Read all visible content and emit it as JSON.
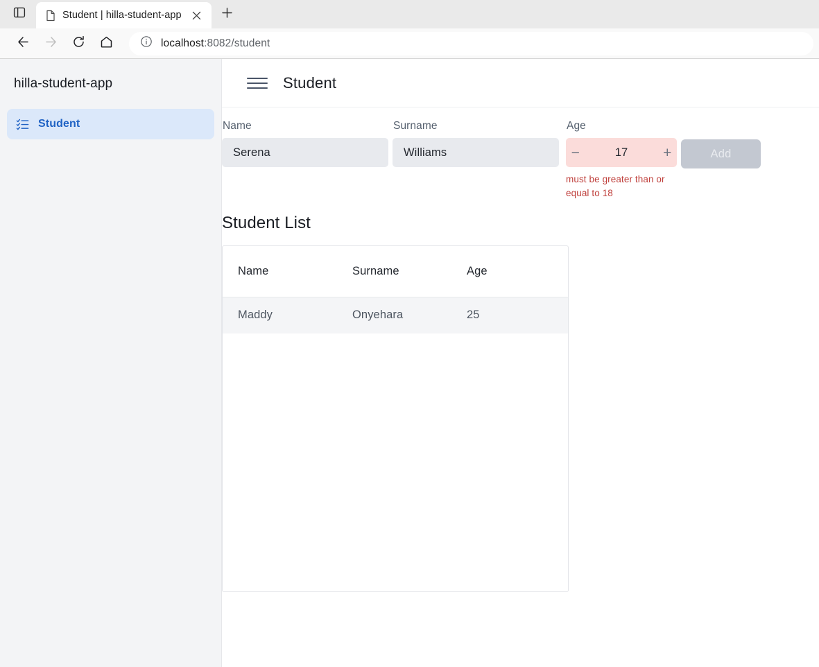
{
  "browser": {
    "tab": {
      "title": "Student | hilla-student-app",
      "favicon_icon": "page-icon",
      "close_icon": "close-icon"
    },
    "new_tab_icon": "plus-icon",
    "tab_search_icon": "tab-list-icon",
    "toolbar": {
      "back_icon": "arrow-left-icon",
      "forward_icon": "arrow-right-icon",
      "reload_icon": "reload-icon",
      "home_icon": "home-icon",
      "site_info_icon": "info-circle-icon",
      "url_host": "localhost",
      "url_path": ":8082/student",
      "url_full": "localhost:8082/student"
    }
  },
  "sidebar": {
    "brand": "hilla-student-app",
    "items": [
      {
        "label": "Student",
        "icon": "checklist-icon",
        "selected": true
      }
    ]
  },
  "header": {
    "menu_icon": "hamburger-icon",
    "title": "Student"
  },
  "form": {
    "name": {
      "label": "Name",
      "value": "Serena",
      "placeholder": ""
    },
    "surname": {
      "label": "Surname",
      "value": "Williams",
      "placeholder": ""
    },
    "age": {
      "label": "Age",
      "value": "17",
      "decrement_icon": "minus-icon",
      "increment_icon": "plus-icon",
      "error": "must be greater than or equal to 18",
      "invalid": true
    },
    "submit": {
      "label": "Add",
      "disabled": true
    }
  },
  "list": {
    "heading": "Student List",
    "columns": [
      "Name",
      "Surname",
      "Age"
    ],
    "rows": [
      {
        "name": "Maddy",
        "surname": "Onyehara",
        "age": "25"
      }
    ]
  },
  "colors": {
    "accent": "#1f62c4",
    "nav_selected_bg": "#dbe8fa",
    "input_bg": "#e8eaee",
    "invalid_bg": "#fbdcda",
    "error_text": "#bf3f3b",
    "disabled_button_bg": "#c3c8d1",
    "sidebar_bg": "#f3f4f6",
    "row_stripe": "#f4f5f7"
  }
}
